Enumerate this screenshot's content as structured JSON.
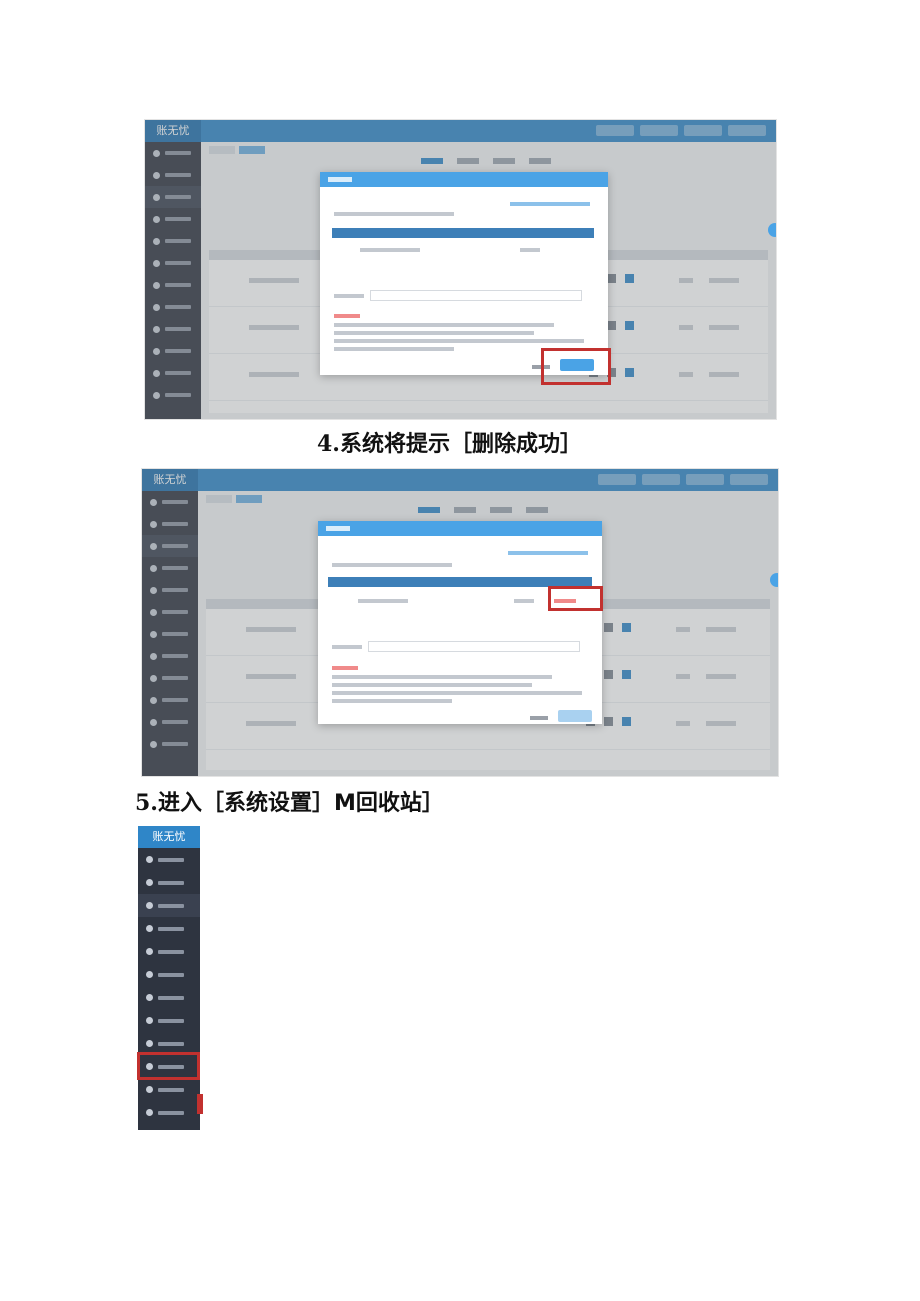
{
  "captions": {
    "step4_number": "4.",
    "step4_text": "系统将提示［删除成功］",
    "step5_number": "5.",
    "step5_text": "进入［系统设置］M回收站］"
  },
  "app": {
    "brand": "账无忧"
  },
  "colors": {
    "topbar": "#2f86c8",
    "sidebar": "#2e3440",
    "dialog_header": "#4aa3e6",
    "highlight_box": "#c2312f"
  }
}
